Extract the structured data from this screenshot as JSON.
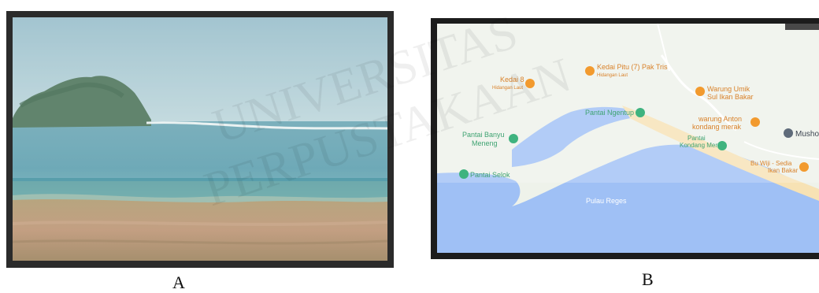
{
  "figure": {
    "panel_a": {
      "caption": "A"
    },
    "panel_b": {
      "caption": "B",
      "map": {
        "pois": [
          {
            "name": "Kedai Pitu (7) Pak Tris",
            "sub": "Hidangan Laut",
            "type": "restaurant"
          },
          {
            "name": "Kedai 8",
            "sub": "Hidangan Laut",
            "type": "restaurant"
          },
          {
            "name": "Warung Umik",
            "sub": "Sul Ikan Bakar",
            "type": "restaurant"
          },
          {
            "name": "Pantai Ngentup",
            "sub": "",
            "type": "park"
          },
          {
            "name": "warung Anton",
            "sub": "kondang merak",
            "type": "restaurant"
          },
          {
            "name": "Pantai Banyu",
            "sub": "Meneng",
            "type": "park"
          },
          {
            "name": "Pantai",
            "sub": "Kondang Merak",
            "type": "park"
          },
          {
            "name": "Musholla",
            "sub": "",
            "type": "mosque"
          },
          {
            "name": "Bu Wiji - Sedia",
            "sub": "Ikan Bakar",
            "type": "restaurant"
          },
          {
            "name": "Pantai Selok",
            "sub": "",
            "type": "park"
          }
        ],
        "water_label": "Pulau Reges",
        "colors": {
          "land": "#eef2ea",
          "water": "#9fc0f5",
          "sand": "#f7e2b4",
          "restaurant": "#f29a2e",
          "park": "#3fb37f",
          "mosque": "#5f6b7a"
        }
      }
    },
    "watermark": {
      "lines": [
        "UNIVERSITAS",
        "PERPUSTAKAAN"
      ]
    }
  }
}
